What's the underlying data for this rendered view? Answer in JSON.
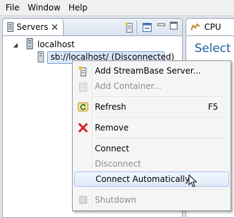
{
  "menubar": {
    "items": [
      "File",
      "Window",
      "Help"
    ]
  },
  "servers_view": {
    "tab_label": "Servers",
    "tree": {
      "root": "localhost",
      "child": "sb://localhost/ (Disconnected)"
    }
  },
  "cpu_view": {
    "tab_label": "CPU",
    "heading": "Select a"
  },
  "context_menu": {
    "items": [
      {
        "label": "Add StreamBase Server...",
        "enabled": true,
        "icon": "add-server-icon"
      },
      {
        "label": "Add Container...",
        "enabled": false,
        "icon": "add-container-icon"
      },
      {
        "label": "Refresh",
        "shortcut": "F5",
        "enabled": true,
        "icon": "refresh-icon"
      },
      {
        "label": "Remove",
        "enabled": true,
        "icon": "remove-icon"
      },
      {
        "label": "Connect",
        "enabled": true
      },
      {
        "label": "Disconnect",
        "enabled": false
      },
      {
        "label": "Connect Automatically",
        "enabled": true,
        "hovered": true
      },
      {
        "label": "Shutdown",
        "enabled": false,
        "icon": "shutdown-icon"
      }
    ]
  },
  "colors": {
    "selection": "#dbe8f8",
    "link_blue": "#1f5fa0",
    "remove_red": "#d42020"
  }
}
